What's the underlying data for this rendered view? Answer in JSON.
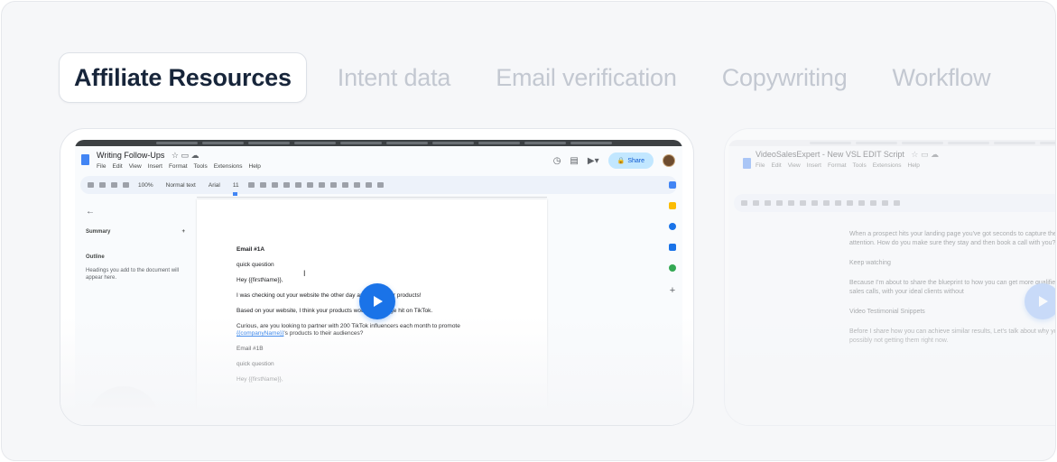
{
  "tabs": [
    {
      "label": "Affiliate Resources",
      "active": true
    },
    {
      "label": "Intent data",
      "active": false
    },
    {
      "label": "Email verification",
      "active": false
    },
    {
      "label": "Copywriting",
      "active": false
    },
    {
      "label": "Workflow",
      "active": false
    }
  ],
  "cards": [
    {
      "doc_title": "Writing Follow-Ups",
      "menu": [
        "File",
        "Edit",
        "View",
        "Insert",
        "Format",
        "Tools",
        "Extensions",
        "Help"
      ],
      "share_label": "Share",
      "toolbar": {
        "zoom": "100%",
        "style": "Normal text",
        "font": "Arial",
        "size": "11"
      },
      "outline": {
        "summary": "Summary",
        "outline_label": "Outline",
        "hint": "Headings you add to the document will appear here."
      },
      "email": {
        "heading_a": "Email #1A",
        "subject": "quick question",
        "greeting": "Hey {{firstName}},",
        "line1": "I was checking out your website the other day and loved your products!",
        "line2": "Based on your website, I think your products would be a huge hit on TikTok.",
        "line3_pre": "Curious, are you looking to partner with 200 TikTok influencers each month to promote ",
        "line3_link": "{{companyName}}",
        "line3_post": "'s products to their audiences?",
        "heading_b": "Email #1B",
        "subject_b": "quick question",
        "greeting_b": "Hey {{firstName}},"
      },
      "colors": {
        "accent": "#1a73e8",
        "share_bg": "#c2e7ff"
      }
    },
    {
      "doc_title": "VideoSalesExpert - New VSL EDIT Script",
      "menu": [
        "File",
        "Edit",
        "View",
        "Insert",
        "Format",
        "Tools",
        "Extensions",
        "Help"
      ],
      "body": [
        "When a prospect hits your landing page you've got seconds to capture their attention. How do you make sure they stay and then book a call with you?",
        "Keep watching",
        "Because I'm about to share the blueprint to how you can get more qualified booked sales calls, with your ideal clients without",
        "Video Testimonial Snippets",
        "Before I share how you can achieve similar results, Let's talk about why you're possibly not getting them right now."
      ]
    }
  ],
  "icons": {
    "play": "play-icon",
    "share": "lock-icon",
    "back": "arrow-left-icon"
  }
}
